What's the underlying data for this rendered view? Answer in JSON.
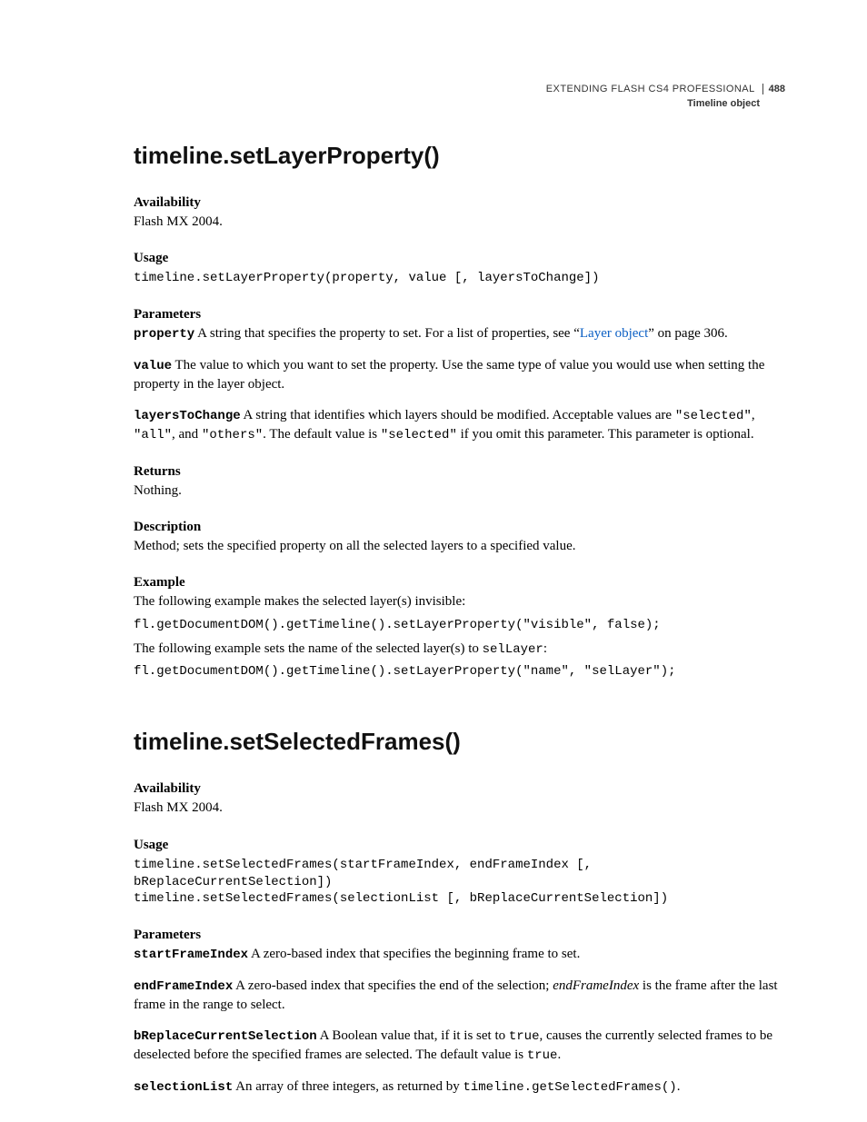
{
  "header": {
    "book_title": "EXTENDING FLASH CS4 PROFESSIONAL",
    "page_number": "488",
    "chapter_title": "Timeline object"
  },
  "section1": {
    "title": "timeline.setLayerProperty()",
    "availability_label": "Availability",
    "availability_text": "Flash MX 2004.",
    "usage_label": "Usage",
    "usage_code": "timeline.setLayerProperty(property, value [, layersToChange])",
    "parameters_label": "Parameters",
    "param1_name": "property",
    "param1_text_a": "  A string that specifies the property to set. For a list of properties, see “",
    "param1_link": "Layer object",
    "param1_text_b": "” on page 306.",
    "param2_name": "value",
    "param2_text": "  The value to which you want to set the property. Use the same type of value you would use when setting the property in the layer object.",
    "param3_name": "layersToChange",
    "param3_text_a": "  A string that identifies which layers should be modified. Acceptable values are ",
    "param3_code1": "\"selected\"",
    "param3_text_b": ", ",
    "param3_code2": "\"all\"",
    "param3_text_c": ", and ",
    "param3_code3": "\"others\"",
    "param3_text_d": ". The default value is ",
    "param3_code4": "\"selected\"",
    "param3_text_e": " if you omit this parameter. This parameter is optional.",
    "returns_label": "Returns",
    "returns_text": "Nothing.",
    "description_label": "Description",
    "description_text": "Method; sets the specified property on all the selected layers to a specified value.",
    "example_label": "Example",
    "example_intro1": "The following example makes the selected layer(s) invisible:",
    "example_code1": "fl.getDocumentDOM().getTimeline().setLayerProperty(\"visible\", false);",
    "example_intro2_a": "The following example sets the name of the selected layer(s) to ",
    "example_intro2_code": "selLayer",
    "example_intro2_b": ":",
    "example_code2": "fl.getDocumentDOM().getTimeline().setLayerProperty(\"name\", \"selLayer\");"
  },
  "section2": {
    "title": "timeline.setSelectedFrames()",
    "availability_label": "Availability",
    "availability_text": "Flash MX 2004.",
    "usage_label": "Usage",
    "usage_code": "timeline.setSelectedFrames(startFrameIndex, endFrameIndex [, bReplaceCurrentSelection])\ntimeline.setSelectedFrames(selectionList [, bReplaceCurrentSelection])",
    "parameters_label": "Parameters",
    "p1_name": "startFrameIndex",
    "p1_text": "  A zero-based index that specifies the beginning frame to set.",
    "p2_name": "endFrameIndex",
    "p2_text_a": "  A zero-based index that specifies the end of the selection; ",
    "p2_italic": "endFrameIndex",
    "p2_text_b": " is the frame after the last frame in the range to select.",
    "p3_name": "bReplaceCurrentSelection",
    "p3_text_a": "  A Boolean value that, if it is set to ",
    "p3_code1": "true",
    "p3_text_b": ", causes the currently selected frames to be deselected before the specified frames are selected. The default value is ",
    "p3_code2": "true",
    "p3_text_c": ".",
    "p4_name": "selectionList",
    "p4_text_a": "  An array of three integers, as returned by ",
    "p4_code1": "timeline.getSelectedFrames()",
    "p4_text_b": "."
  }
}
